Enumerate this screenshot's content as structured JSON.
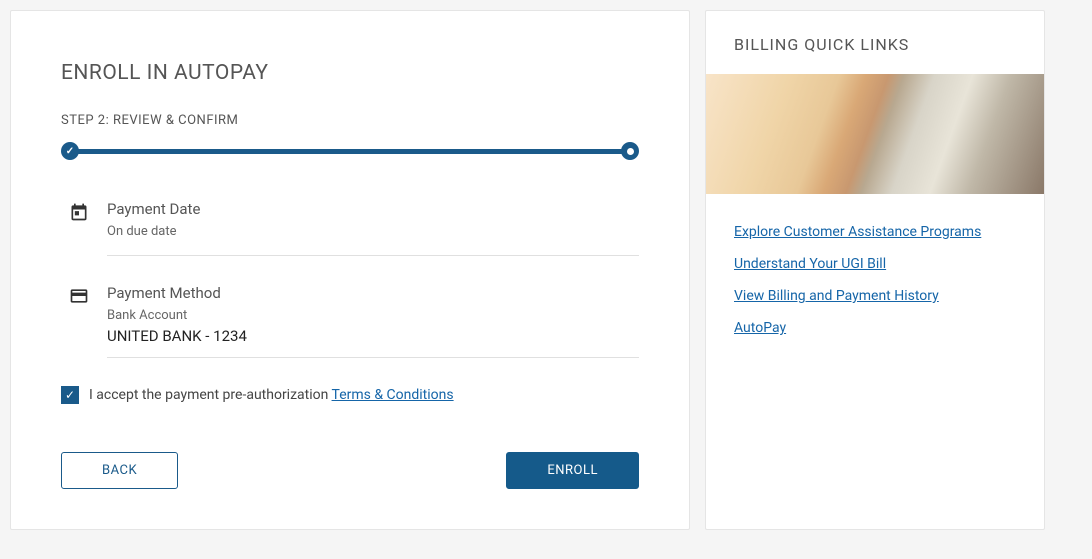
{
  "main": {
    "title": "ENROLL IN AUTOPAY",
    "step_label": "STEP 2: REVIEW & CONFIRM",
    "payment_date": {
      "label": "Payment Date",
      "value": "On due date"
    },
    "payment_method": {
      "label": "Payment Method",
      "sub": "Bank Account",
      "value": "UNITED BANK - 1234"
    },
    "accept": {
      "checked": true,
      "prefix": "I accept the payment pre-authorization ",
      "link": "Terms & Conditions"
    },
    "buttons": {
      "back": "BACK",
      "enroll": "ENROLL"
    }
  },
  "sidebar": {
    "title": "BILLING QUICK LINKS",
    "links": [
      "Explore Customer Assistance Programs",
      "Understand Your UGI Bill",
      "View Billing and Payment History",
      "AutoPay"
    ]
  }
}
